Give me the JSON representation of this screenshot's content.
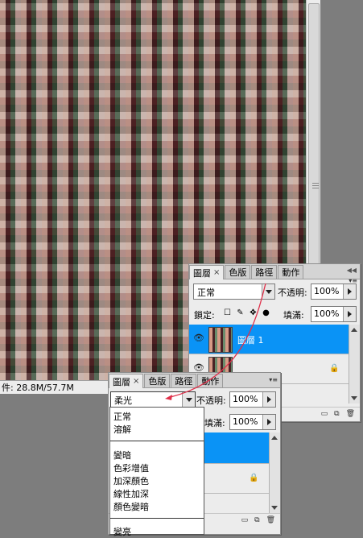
{
  "status": {
    "doc_size": "件: 28.8M/57.7M"
  },
  "back_panel": {
    "tabs": [
      {
        "label": "圖層",
        "close": "×"
      },
      {
        "label": "色版"
      },
      {
        "label": "路徑"
      },
      {
        "label": "動作"
      }
    ],
    "blend_mode": "正常",
    "opacity_label": "不透明:",
    "opacity_value": "100%",
    "lock_label": "鎖定:",
    "fill_label": "填滿:",
    "fill_value": "100%",
    "layers": [
      {
        "name": "圖層 1",
        "selected": true
      }
    ]
  },
  "front_panel": {
    "tabs": [
      {
        "label": "圖層",
        "close": "×"
      },
      {
        "label": "色版"
      },
      {
        "label": "路徑"
      },
      {
        "label": "動作"
      }
    ],
    "blend_mode": "柔光",
    "opacity_label": "不透明:",
    "opacity_value": "100%",
    "fill_label": "填滿:",
    "fill_value": "100%"
  },
  "blend_menu": {
    "group1": [
      "正常",
      "溶解"
    ],
    "group2": [
      "變暗",
      "色彩增值",
      "加深顏色",
      "線性加深",
      "顏色變暗"
    ],
    "group3": [
      "變亮"
    ]
  },
  "colors": {
    "selection": "#0a93f6",
    "arrow": "#e0304a"
  }
}
